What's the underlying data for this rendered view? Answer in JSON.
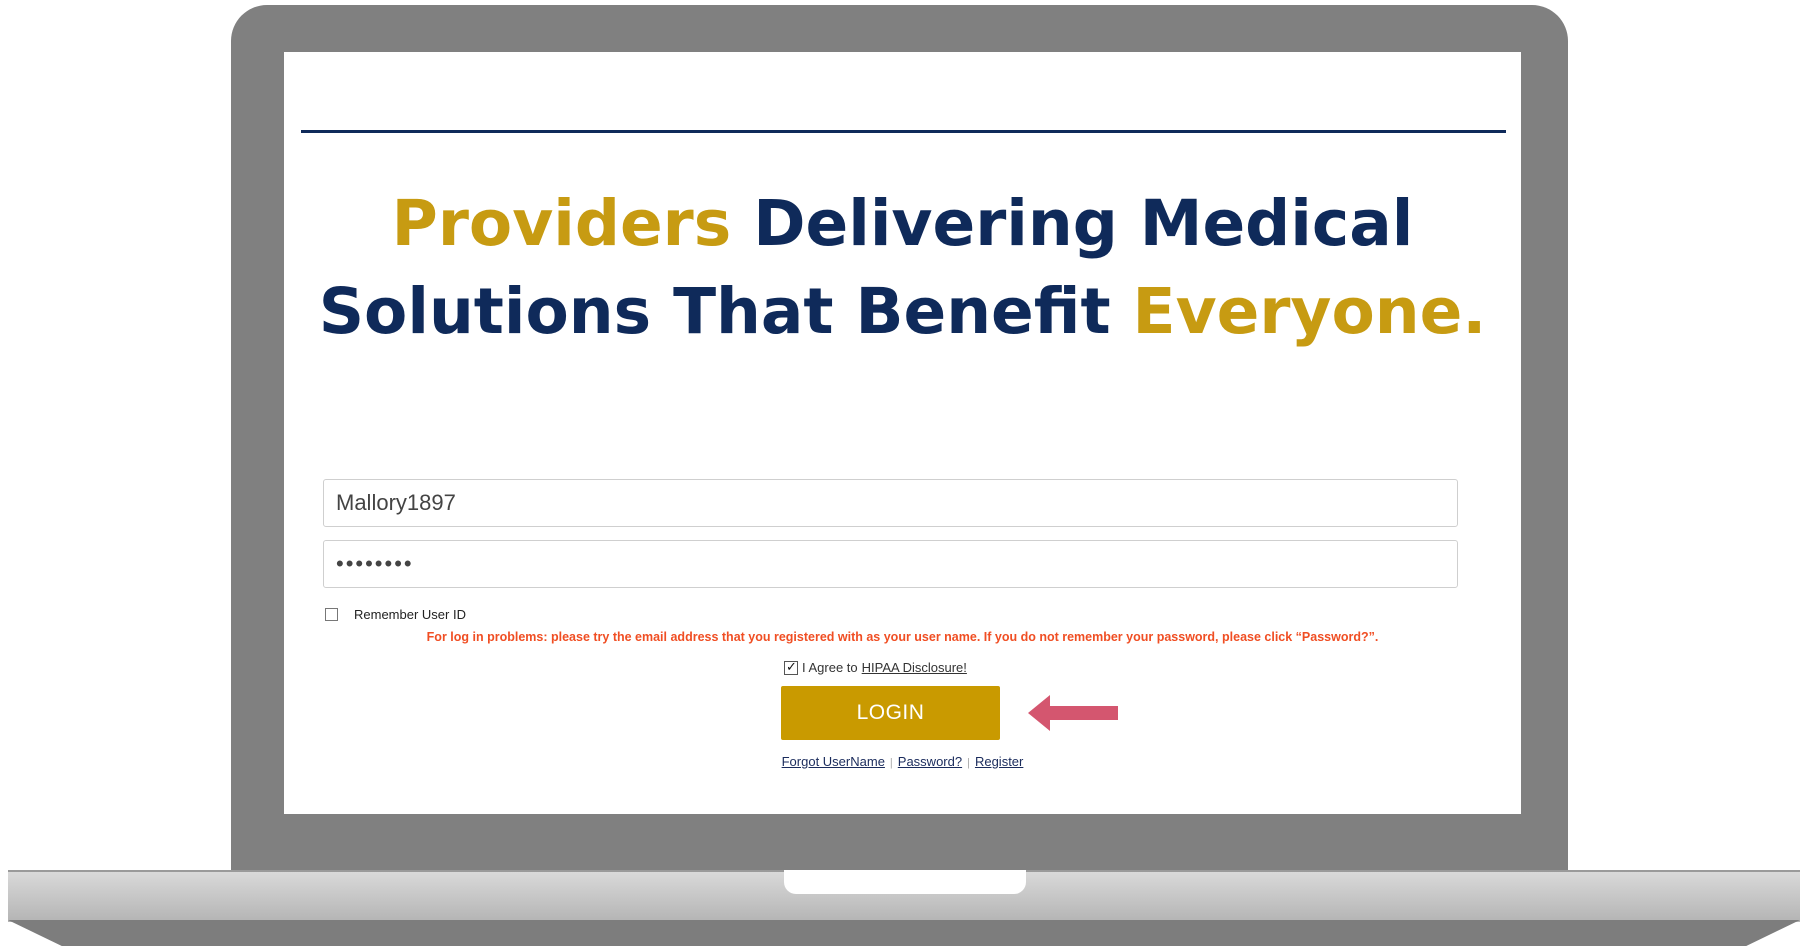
{
  "headline": {
    "line1_gold": "Providers",
    "line1_navy": " Delivering Medical",
    "line2_navy": "Solutions That Benefit ",
    "line2_gold": "Everyone."
  },
  "login_form": {
    "username_value": "Mallory1897",
    "password_value": "••••••••",
    "remember_label": "Remember User ID",
    "remember_checked": false,
    "problems_text": "For log in problems: please try the email address that you registered with as your user name. If you do not remember your password, please click “Password?”.",
    "agree_prefix": "I Agree to",
    "agree_link": "HIPAA Disclosure!",
    "agree_checked": true,
    "login_label": "LOGIN"
  },
  "footer_links": {
    "forgot_username": "Forgot UserName",
    "separator": "|",
    "password": "Password?",
    "register": "Register"
  },
  "colors": {
    "navy": "#0f2a5a",
    "gold": "#c79b12",
    "button": "#c99a00",
    "warning": "#f04e23",
    "arrow": "#d4566f"
  }
}
